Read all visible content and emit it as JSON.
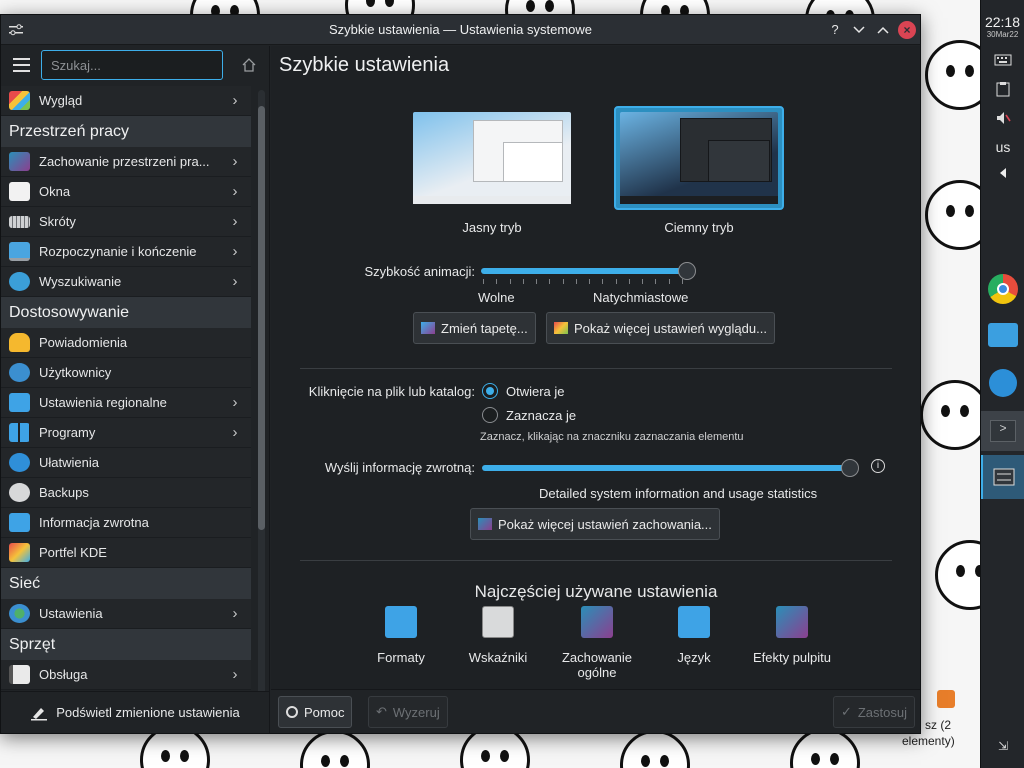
{
  "window": {
    "title": "Szybkie ustawienia — Ustawienia systemowe"
  },
  "sidebar": {
    "search_placeholder": "Szukaj...",
    "items": [
      {
        "label": "Wygląd",
        "chevron": true
      },
      {
        "category": "Przestrzeń pracy"
      },
      {
        "label": "Zachowanie przestrzeni pra...",
        "chevron": true
      },
      {
        "label": "Okna",
        "chevron": true
      },
      {
        "label": "Skróty",
        "chevron": true
      },
      {
        "label": "Rozpoczynanie i kończenie",
        "chevron": true
      },
      {
        "label": "Wyszukiwanie",
        "chevron": true
      },
      {
        "category": "Dostosowywanie"
      },
      {
        "label": "Powiadomienia",
        "chevron": false
      },
      {
        "label": "Użytkownicy",
        "chevron": false
      },
      {
        "label": "Ustawienia regionalne",
        "chevron": true
      },
      {
        "label": "Programy",
        "chevron": true
      },
      {
        "label": "Ułatwienia",
        "chevron": false
      },
      {
        "label": "Backups",
        "chevron": false
      },
      {
        "label": "Informacja zwrotna",
        "chevron": false
      },
      {
        "label": "Portfel KDE",
        "chevron": false
      },
      {
        "category": "Sieć"
      },
      {
        "label": "Ustawienia",
        "chevron": true
      },
      {
        "category": "Sprzęt"
      },
      {
        "label": "Obsługa",
        "chevron": true
      }
    ],
    "highlight_changed_label": "Podświetl zmienione ustawienia"
  },
  "main": {
    "title": "Szybkie ustawienia",
    "themes": {
      "light_label": "Jasny tryb",
      "dark_label": "Ciemny tryb",
      "selected": "dark"
    },
    "animation": {
      "label": "Szybkość animacji:",
      "min_label": "Wolne",
      "max_label": "Natychmiastowe",
      "value_fraction": 1.0
    },
    "change_wallpaper_label": "Zmień tapetę...",
    "more_appearance_label": "Pokaż więcej ustawień wyglądu...",
    "click_behavior": {
      "label": "Kliknięcie na plik lub katalog:",
      "option_open": "Otwiera je",
      "option_select": "Zaznacza je",
      "hint": "Zaznacz, klikając na znaczniku zaznaczania elementu",
      "selected": "open"
    },
    "feedback": {
      "label": "Wyślij informację zwrotną:",
      "description": "Detailed system information and usage statistics",
      "value_fraction": 1.0
    },
    "more_behavior_label": "Pokaż więcej ustawień zachowania...",
    "frequent": {
      "heading": "Najczęściej używane ustawienia",
      "items": [
        {
          "label": "Formaty"
        },
        {
          "label": "Wskaźniki"
        },
        {
          "label": "Zachowanie ogólne"
        },
        {
          "label": "Język"
        },
        {
          "label": "Efekty pulpitu"
        }
      ]
    }
  },
  "footer": {
    "help_label": "Pomoc",
    "reset_label": "Wyzeruj",
    "apply_label": "Zastosuj"
  },
  "panel": {
    "time": "22:18",
    "date": "30Mar22",
    "keyboard_layout": "us"
  },
  "desktop": {
    "partial_label_1": "sz (2",
    "partial_label_2": "elementy)"
  },
  "colors": {
    "accent": "#3daee9",
    "window_bg": "#202326",
    "close": "#da4453"
  }
}
